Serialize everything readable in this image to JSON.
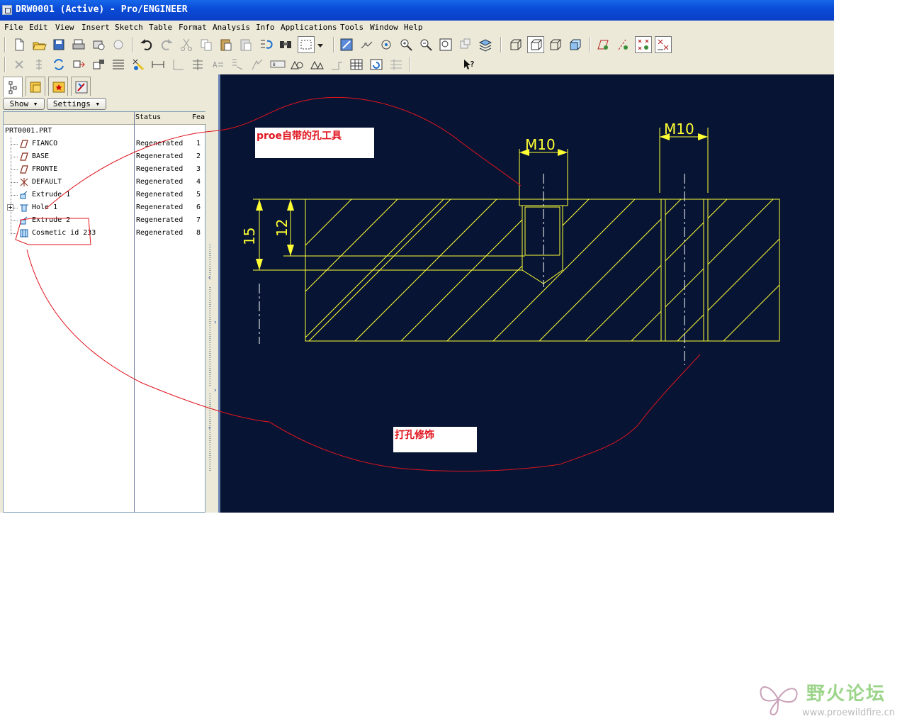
{
  "window": {
    "title": "DRW0001 (Active) - Pro/ENGINEER"
  },
  "menu": [
    "File",
    "Edit",
    "View",
    "Insert",
    "Sketch",
    "Table",
    "Format",
    "Analysis",
    "Info",
    "Applications",
    "Tools",
    "Window",
    "Help"
  ],
  "toolbar": {
    "numeric_value": "0"
  },
  "panel": {
    "show_label": "Show",
    "settings_label": "Settings"
  },
  "tree": {
    "header": {
      "status": "Status",
      "feat": "Fea"
    },
    "root": "PRT0001.PRT",
    "items": [
      {
        "label": "FIANCO",
        "status": "Regenerated",
        "num": "1",
        "icon": "datum-plane-icon"
      },
      {
        "label": "BASE",
        "status": "Regenerated",
        "num": "2",
        "icon": "datum-plane-icon"
      },
      {
        "label": "FRONTE",
        "status": "Regenerated",
        "num": "3",
        "icon": "datum-plane-icon"
      },
      {
        "label": "DEFAULT",
        "status": "Regenerated",
        "num": "4",
        "icon": "coordinate-system-icon"
      },
      {
        "label": "Extrude 1",
        "status": "Regenerated",
        "num": "5",
        "icon": "extrude-icon"
      },
      {
        "label": "Hole 1",
        "status": "Regenerated",
        "num": "6",
        "icon": "hole-icon"
      },
      {
        "label": "Extrude 2",
        "status": "Regenerated",
        "num": "7",
        "icon": "extrude-icon"
      },
      {
        "label": "Cosmetic id 233",
        "status": "Regenerated",
        "num": "8",
        "icon": "cosmetic-thread-icon"
      }
    ]
  },
  "drawing": {
    "dim_m10_left": "M10",
    "dim_m10_right": "M10",
    "dim_15": "15",
    "dim_12": "12"
  },
  "annotations": {
    "note_top": "proe自带的孔工具",
    "note_bottom": "打孔修饰"
  },
  "watermark": {
    "brand": "野火论坛",
    "url": "www.proewildfire.cn"
  },
  "colors": {
    "canvas_bg": "#071434",
    "drawing_lines": "#ffff33",
    "markup": "#e0141e"
  }
}
